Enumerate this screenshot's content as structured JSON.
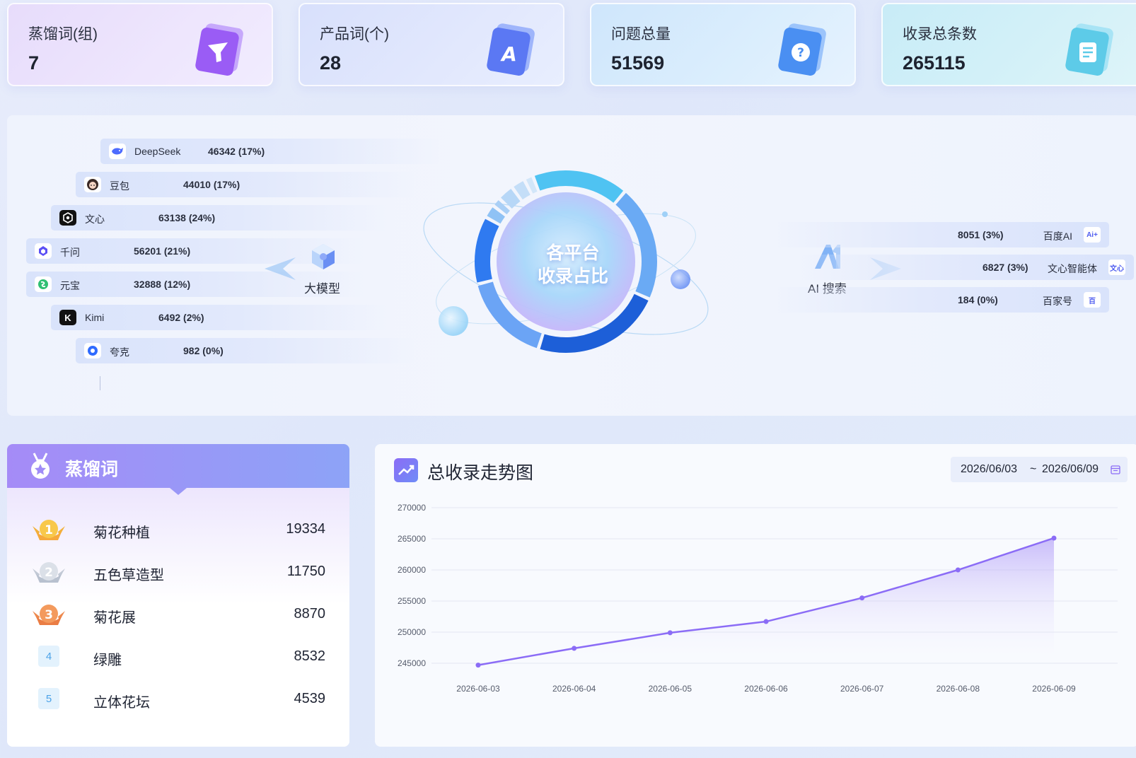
{
  "kpis": [
    {
      "label": "蒸馏词(组)",
      "value": "7",
      "icon": "funnel-icon"
    },
    {
      "label": "产品词(个)",
      "value": "28",
      "icon": "letter-a-icon"
    },
    {
      "label": "问题总量",
      "value": "51569",
      "icon": "question-icon"
    },
    {
      "label": "收录总条数",
      "value": "265115",
      "icon": "document-icon"
    }
  ],
  "platform_share": {
    "center_title_line1": "各平台",
    "center_title_line2": "收录占比",
    "left_group_label": "大模型",
    "right_group_label": "AI 搜索",
    "left_items": [
      {
        "name": "DeepSeek",
        "value": "46342 (17%)",
        "icon": "deepseek-whale-icon"
      },
      {
        "name": "豆包",
        "value": "44010 (17%)",
        "icon": "doubao-avatar-icon"
      },
      {
        "name": "文心",
        "value": "63138 (24%)",
        "icon": "wenxin-icon"
      },
      {
        "name": "千问",
        "value": "56201 (21%)",
        "icon": "qianwen-icon"
      },
      {
        "name": "元宝",
        "value": "32888 (12%)",
        "icon": "yuanbao-icon"
      },
      {
        "name": "Kimi",
        "value": "6492 (2%)",
        "icon": "kimi-icon"
      },
      {
        "name": "夸克",
        "value": "982 (0%)",
        "icon": "quark-icon"
      }
    ],
    "right_items": [
      {
        "name": "百度AI",
        "value": "8051 (3%)",
        "icon_text": "Ai+",
        "icon": "baidu-ai-icon"
      },
      {
        "name": "文心智能体",
        "value": "6827 (3%)",
        "icon_text": "文心",
        "icon": "wenxin-agent-icon"
      },
      {
        "name": "百家号",
        "value": "184 (0%)",
        "icon_text": "百",
        "icon": "baijiahao-icon"
      }
    ]
  },
  "ranking": {
    "title": "蒸馏词",
    "items": [
      {
        "rank": "1",
        "name": "菊花种植",
        "count": "19334"
      },
      {
        "rank": "2",
        "name": "五色草造型",
        "count": "11750"
      },
      {
        "rank": "3",
        "name": "菊花展",
        "count": "8870"
      },
      {
        "rank": "4",
        "name": "绿雕",
        "count": "8532"
      },
      {
        "rank": "5",
        "name": "立体花坛",
        "count": "4539"
      }
    ]
  },
  "trend": {
    "title": "总收录走势图",
    "date_start": "2026/06/03",
    "date_sep": "~",
    "date_end": "2026/06/09"
  },
  "colors": {
    "line": "#8b6cf6",
    "ring_light": "#4fc3f2",
    "ring_mid": "#6ba4f5",
    "ring_dark": "#1d5fd8",
    "rank_header": "#9a97f7"
  },
  "chart_data": [
    {
      "type": "line",
      "title": "总收录走势图",
      "xlabel": "",
      "ylabel": "",
      "x": [
        "2026-06-03",
        "2026-06-04",
        "2026-06-05",
        "2026-06-06",
        "2026-06-07",
        "2026-06-08",
        "2026-06-09"
      ],
      "series": [
        {
          "values": [
            244700,
            247400,
            249900,
            251700,
            255500,
            260000,
            265115
          ]
        }
      ],
      "ylim": [
        245000,
        270000
      ],
      "yticks": [
        270000,
        265000,
        260000,
        255000,
        250000,
        245000
      ],
      "grid": true,
      "area_fill": true
    },
    {
      "type": "pie",
      "title": "各平台收录占比",
      "categories": [
        "DeepSeek",
        "豆包",
        "文心",
        "千问",
        "元宝",
        "Kimi",
        "夸克",
        "百度AI",
        "文心智能体",
        "百家号"
      ],
      "values": [
        46342,
        44010,
        63138,
        56201,
        32888,
        6492,
        982,
        8051,
        6827,
        184
      ]
    }
  ]
}
